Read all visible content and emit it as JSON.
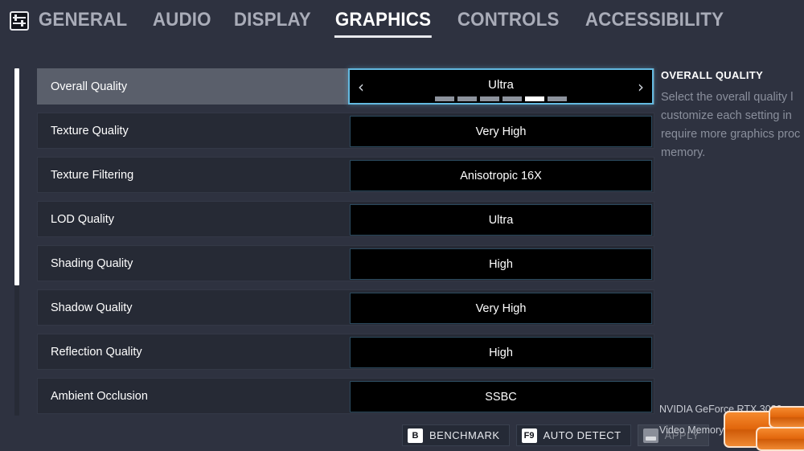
{
  "nav": {
    "icon": "sliders-icon",
    "tabs": [
      {
        "label": "GENERAL",
        "active": false
      },
      {
        "label": "AUDIO",
        "active": false
      },
      {
        "label": "DISPLAY",
        "active": false
      },
      {
        "label": "GRAPHICS",
        "active": true
      },
      {
        "label": "CONTROLS",
        "active": false
      },
      {
        "label": "ACCESSIBILITY",
        "active": false
      }
    ]
  },
  "settings": [
    {
      "label": "Overall Quality",
      "value": "Ultra",
      "selected": true,
      "segments": {
        "count": 6,
        "active_index": 4
      },
      "arrows": {
        "left": "‹",
        "right": "›"
      }
    },
    {
      "label": "Texture Quality",
      "value": "Very High",
      "selected": false
    },
    {
      "label": "Texture Filtering",
      "value": "Anisotropic 16X",
      "selected": false
    },
    {
      "label": "LOD Quality",
      "value": "Ultra",
      "selected": false
    },
    {
      "label": "Shading Quality",
      "value": "High",
      "selected": false
    },
    {
      "label": "Shadow Quality",
      "value": "Very High",
      "selected": false
    },
    {
      "label": "Reflection Quality",
      "value": "High",
      "selected": false
    },
    {
      "label": "Ambient Occlusion",
      "value": "SSBC",
      "selected": false
    }
  ],
  "description": {
    "title": "OVERALL QUALITY",
    "body": "Select the overall quality l\ncustomize each setting in\nrequire more graphics proc\nmemory."
  },
  "bottom_buttons": [
    {
      "key": "B",
      "label": "BENCHMARK",
      "disabled": false
    },
    {
      "key": "F9",
      "label": "AUTO DETECT",
      "disabled": false
    },
    {
      "key": "",
      "label": "APPLY",
      "disabled": true
    }
  ],
  "gpu": {
    "name": "NVIDIA GeForce RTX 3080",
    "video_memory_label": "Video Memory:"
  },
  "colors": {
    "background": "#2e3240",
    "row": "#262a35",
    "row_selected": "#5a5f6b",
    "value_box": "#000000",
    "accent": "#63b9e0",
    "muted_text": "#8a8f9c",
    "watermark": "#e2660c"
  }
}
